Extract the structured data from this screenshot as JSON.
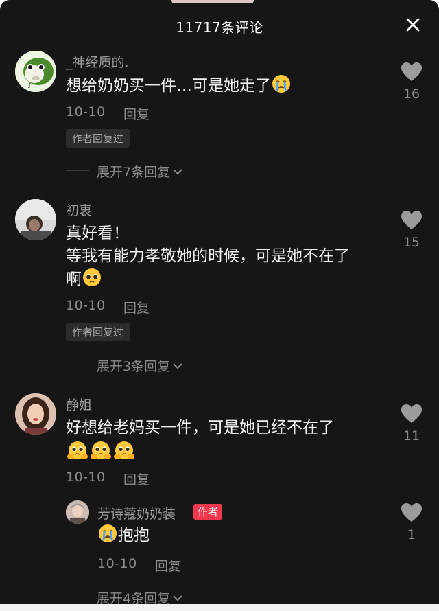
{
  "header": {
    "title": "11717条评论",
    "close_icon": "close-icon"
  },
  "comments": [
    {
      "username": "_神经质的.",
      "text": "想给奶奶买一件…可是她走了",
      "date": "10-10",
      "reply_label": "回复",
      "author_replied": "作者回复过",
      "expand_label": "展开7条回复",
      "likes": "16"
    },
    {
      "username": "初衷",
      "text_line1": "真好看！",
      "text_line2": "等我有能力孝敬她的时候，可是她不在了",
      "text_line3": "啊",
      "date": "10-10",
      "reply_label": "回复",
      "author_replied": "作者回复过",
      "expand_label": "展开3条回复",
      "likes": "15"
    },
    {
      "username": "静姐",
      "text": "好想给老妈买一件，可是她已经不在了",
      "date": "10-10",
      "reply_label": "回复",
      "likes": "11",
      "reply": {
        "username": "芳诗蔻奶奶装",
        "badge": "作者",
        "text": "抱抱",
        "date": "10-10",
        "reply_label": "回复",
        "likes": "1"
      },
      "expand_label": "展开4条回复"
    }
  ],
  "colors": {
    "background": "#161616",
    "author_badge": "#f0394f",
    "muted": "#8b8b8b"
  }
}
